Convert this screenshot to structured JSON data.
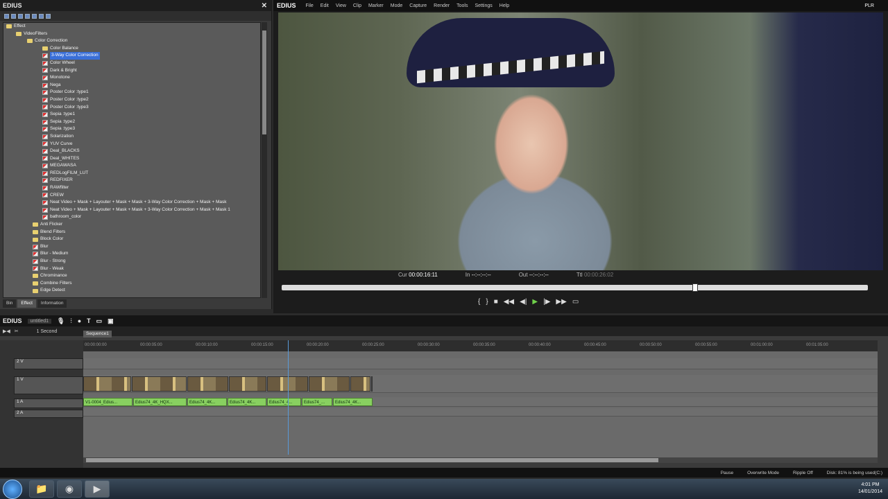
{
  "effect_panel": {
    "title": "EDIUS",
    "tree": {
      "root": "Effect",
      "video_filters": "VideoFilters",
      "color_correction": "Color Correction",
      "cc_items": [
        "Color Balance",
        "3-Way Color Correction",
        "Color Wheel",
        "Dark & Bright",
        "Monotone",
        "Nega",
        "Poster Color :type1",
        "Poster Color :type2",
        "Poster Color :type3",
        "Sepia :type1",
        "Sepia :type2",
        "Sepia :type3",
        "Solarization",
        "YUV Curve",
        "Deal_BLACKS",
        "Deal_WHITES",
        "MEGAWASA",
        "REDLogFILM_LUT",
        "REDFIXER",
        "RAWfilter",
        "CREW",
        "Neat Video + Mask + Layouter + Mask + Mask + 3-Way Color Correction + Mask + Mask",
        "Neat Video + Mask + Layouter + Mask + Mask + 3-Way Color Correction + Mask + Mask 1",
        "bathroom_color"
      ],
      "selected": "3-Way Color Correction",
      "filter_folders": [
        "Anti Flicker",
        "Blend Filters",
        "Block Color",
        "Blur",
        "Blur - Medium",
        "Blur - Strong",
        "Blur - Weak",
        "Chrominance",
        "Combine Filters",
        "Edge Detect"
      ]
    },
    "tabs": [
      "Bin",
      "Effect",
      "Information"
    ],
    "active_tab": "Effect"
  },
  "player": {
    "brand": "EDIUS",
    "menu": [
      "File",
      "Edit",
      "View",
      "Clip",
      "Marker",
      "Mode",
      "Capture",
      "Render",
      "Tools",
      "Settings",
      "Help"
    ],
    "mode_badge": "PLR",
    "timecodes": {
      "cur_label": "Cur",
      "cur": "00:00:16:11",
      "in_label": "In",
      "in": "--:--:--:--",
      "out_label": "Out",
      "out": "--:--:--:--",
      "ttl_label": "Ttl",
      "ttl": "00:00:26:02"
    },
    "transport": {
      "prev": "◀◀",
      "rew": "◀|",
      "stop": "■",
      "back": "◀◀",
      "play": "▶",
      "fwd": "▶▶",
      "next": "|▶"
    }
  },
  "timeline": {
    "title": "EDIUS",
    "project": "untitled1",
    "sequence_tab": "Sequence1",
    "zoom": "1 Second",
    "ruler": [
      "00:00:00:00",
      "00:00:05:00",
      "00:00:10:00",
      "00:00:15:00",
      "00:00:20:00",
      "00:00:25:00",
      "00:00:30:00",
      "00:00:35:00",
      "00:00:40:00",
      "00:00:45:00",
      "00:00:50:00",
      "00:00:55:00",
      "00:01:00:00",
      "00:01:05:00"
    ],
    "tracks": [
      "2 V",
      "1 V",
      "1 A",
      "2 A"
    ],
    "audio_clips": [
      "V1-0004_Edius...",
      "Edius74_4K_HQX...",
      "Edius74_4K...",
      "Edius74_4K...",
      "Edius74_4...",
      "Edius74_...",
      "Edius74_4K..."
    ]
  },
  "status": {
    "pause": "Pause",
    "overwrite": "Overwrite Mode",
    "ripple": "Ripple Off",
    "disk": "Disk: 81% is being used(C:)"
  },
  "taskbar": {
    "time": "4:01 PM",
    "date": "14/01/2014"
  }
}
